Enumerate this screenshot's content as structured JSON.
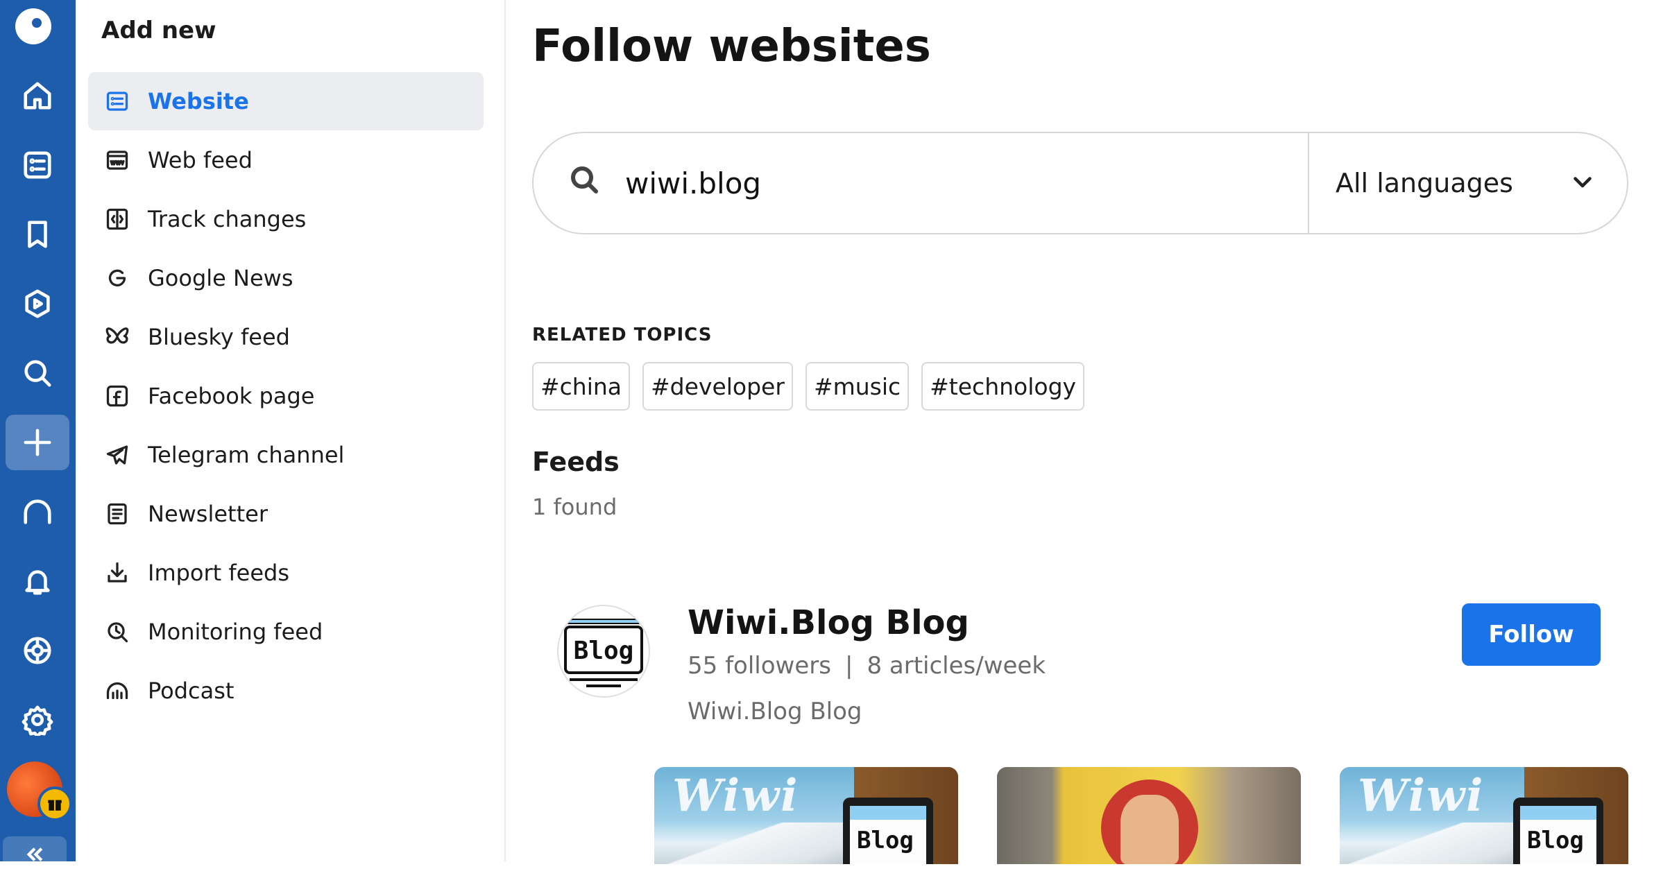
{
  "sidebar": {
    "title": "Add new",
    "items": [
      {
        "label": "Website",
        "icon": "website-icon",
        "active": true
      },
      {
        "label": "Web feed",
        "icon": "web-feed-icon"
      },
      {
        "label": "Track changes",
        "icon": "track-changes-icon"
      },
      {
        "label": "Google News",
        "icon": "google-icon"
      },
      {
        "label": "Bluesky feed",
        "icon": "butterfly-icon"
      },
      {
        "label": "Facebook page",
        "icon": "facebook-icon"
      },
      {
        "label": "Telegram channel",
        "icon": "telegram-icon"
      },
      {
        "label": "Newsletter",
        "icon": "newsletter-icon"
      },
      {
        "label": "Import feeds",
        "icon": "import-icon"
      },
      {
        "label": "Monitoring feed",
        "icon": "monitoring-icon"
      },
      {
        "label": "Podcast",
        "icon": "podcast-icon"
      }
    ]
  },
  "rail": {
    "items": [
      "home-icon",
      "feeds-icon",
      "bookmark-icon",
      "video-icon",
      "search-icon",
      "add-icon",
      "headphones-icon",
      "bell-icon",
      "integrations-icon",
      "settings-icon"
    ],
    "active": "add-icon"
  },
  "main": {
    "title": "Follow websites",
    "search": {
      "value": "wiwi.blog"
    },
    "language": {
      "selected": "All languages"
    },
    "related_topics": {
      "title": "RELATED TOPICS",
      "tags": [
        "#china",
        "#developer",
        "#music",
        "#technology"
      ]
    },
    "feeds": {
      "title": "Feeds",
      "found": "1 found",
      "items": [
        {
          "name": "Wiwi.Blog Blog",
          "followers": "55 followers",
          "separator": "|",
          "frequency": "8 articles/week",
          "description": "Wiwi.Blog Blog",
          "follow_label": "Follow",
          "avatar_text": "Blog"
        }
      ]
    },
    "thumbnails": [
      {
        "text": "Wiwi",
        "screen_text": "Blog"
      },
      {
        "text": ""
      },
      {
        "text": "Wiwi",
        "screen_text": "Blog"
      }
    ]
  },
  "colors": {
    "rail": "#1e5dac",
    "accent": "#1a73e8",
    "gift": "#f5b900"
  }
}
